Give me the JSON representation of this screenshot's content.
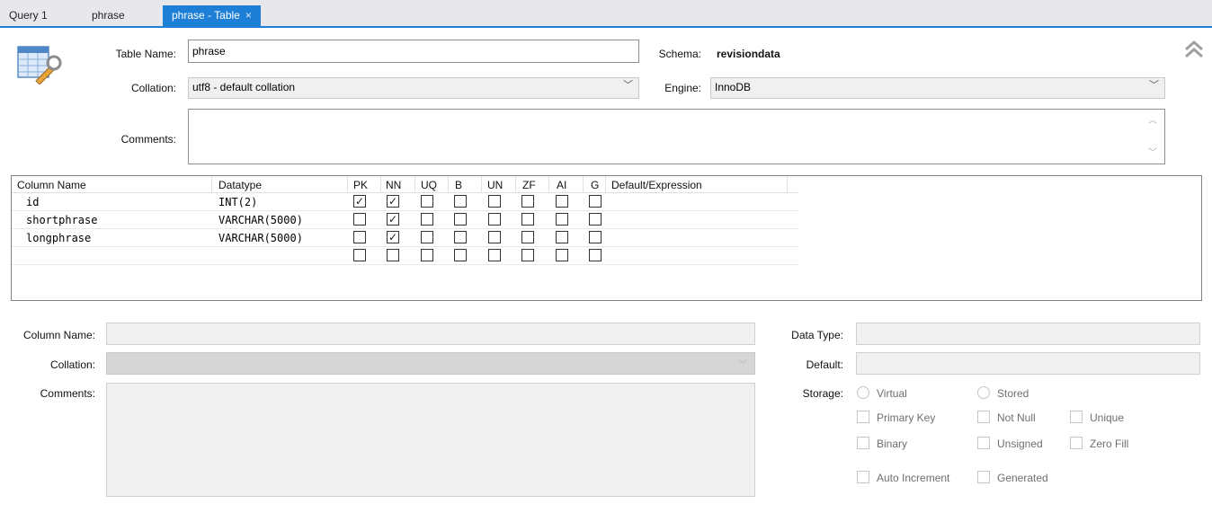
{
  "tabs": [
    {
      "label": "Query 1"
    },
    {
      "label": "phrase"
    },
    {
      "label": "phrase - Table",
      "close": "×"
    }
  ],
  "table": {
    "table_name_label": "Table Name:",
    "table_name_value": "phrase",
    "schema_label": "Schema:",
    "schema_value": "revisiondata",
    "collation_label": "Collation:",
    "collation_value": "utf8 - default collation",
    "engine_label": "Engine:",
    "engine_value": "InnoDB",
    "comments_label": "Comments:"
  },
  "grid": {
    "headers": [
      "Column Name",
      "Datatype",
      "PK",
      "NN",
      "UQ",
      "B",
      "UN",
      "ZF",
      "AI",
      "G",
      "Default/Expression"
    ],
    "rows": [
      {
        "name": "id",
        "datatype": "INT(2)",
        "flags": [
          true,
          true,
          false,
          false,
          false,
          false,
          false,
          false
        ]
      },
      {
        "name": "shortphrase",
        "datatype": "VARCHAR(5000)",
        "flags": [
          false,
          true,
          false,
          false,
          false,
          false,
          false,
          false
        ]
      },
      {
        "name": "longphrase",
        "datatype": "VARCHAR(5000)",
        "flags": [
          false,
          true,
          false,
          false,
          false,
          false,
          false,
          false
        ]
      },
      {
        "name": "",
        "datatype": "",
        "flags": [
          false,
          false,
          false,
          false,
          false,
          false,
          false,
          false
        ]
      }
    ]
  },
  "detail": {
    "column_name_label": "Column Name:",
    "collation_label": "Collation:",
    "comments_label": "Comments:",
    "data_type_label": "Data Type:",
    "default_label": "Default:",
    "storage_label": "Storage:",
    "virtual": "Virtual",
    "stored": "Stored",
    "primary_key": "Primary Key",
    "not_null": "Not Null",
    "unique": "Unique",
    "binary": "Binary",
    "unsigned": "Unsigned",
    "zero_fill": "Zero Fill",
    "auto_increment": "Auto Increment",
    "generated": "Generated"
  },
  "icons": {
    "table_icon": "table-settings-icon",
    "collapse": "double-chevron-up-icon",
    "dropdown": "chevron-down-icon"
  },
  "colors": {
    "accent": "#1e7fd6"
  }
}
